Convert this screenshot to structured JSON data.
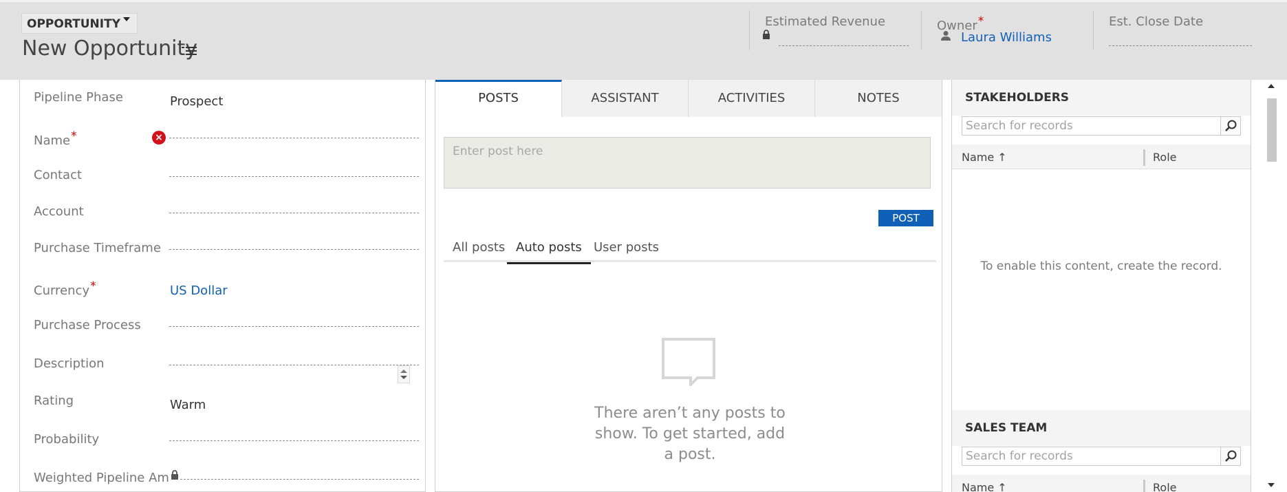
{
  "header": {
    "entity_type": "OPPORTUNITY",
    "record_title": "New Opportunity",
    "fields": [
      {
        "label": "Estimated Revenue",
        "value": ""
      },
      {
        "label": "Owner",
        "required": true,
        "value": "Laura Williams"
      },
      {
        "label": "Est. Close Date",
        "value": ""
      }
    ],
    "required_marker": "*"
  },
  "form": {
    "fields": [
      {
        "label": "Pipeline Phase",
        "value": "Prospect"
      },
      {
        "label": "Name",
        "value": "",
        "required": true,
        "error": true
      },
      {
        "label": "Contact",
        "value": ""
      },
      {
        "label": "Account",
        "value": ""
      },
      {
        "label": "Purchase Timeframe",
        "value": ""
      },
      {
        "label": "Currency",
        "value": "US Dollar",
        "required": true
      },
      {
        "label": "Purchase Process",
        "value": ""
      },
      {
        "label": "Description",
        "value": ""
      },
      {
        "label": "Rating",
        "value": "Warm"
      },
      {
        "label": "Probability",
        "value": ""
      },
      {
        "label": "Weighted Pipeline Am",
        "value": "",
        "locked": true
      }
    ],
    "error_glyph": "×"
  },
  "social": {
    "tabs": [
      "POSTS",
      "ASSISTANT",
      "ACTIVITIES",
      "NOTES"
    ],
    "active_tab": "POSTS",
    "post_placeholder": "Enter post here",
    "post_button": "POST",
    "subtabs": [
      "All posts",
      "Auto posts",
      "User posts"
    ],
    "active_subtab": "Auto posts",
    "empty_message": "There aren’t any posts to show. To get started, add a post."
  },
  "stakeholders": {
    "title": "STAKEHOLDERS",
    "search_placeholder": "Search for records",
    "columns": [
      "Name",
      "Role"
    ],
    "sort_glyph": "↑",
    "empty_text": "To enable this content, create the record."
  },
  "sales_team": {
    "title": "SALES TEAM",
    "search_placeholder": "Search for records",
    "columns": [
      "Name",
      "Role"
    ],
    "sort_glyph": "↑"
  },
  "icons": {
    "title_menu": "list-menu-icon",
    "lock": "lock-icon",
    "user": "user-icon",
    "error": "error-icon",
    "search": "search-icon",
    "empty_posts": "speech-bubble-icon"
  },
  "colors": {
    "accent": "#1160b7",
    "error": "#d3111b",
    "header_bg": "#e1e1e1",
    "required": "#dd0000"
  }
}
